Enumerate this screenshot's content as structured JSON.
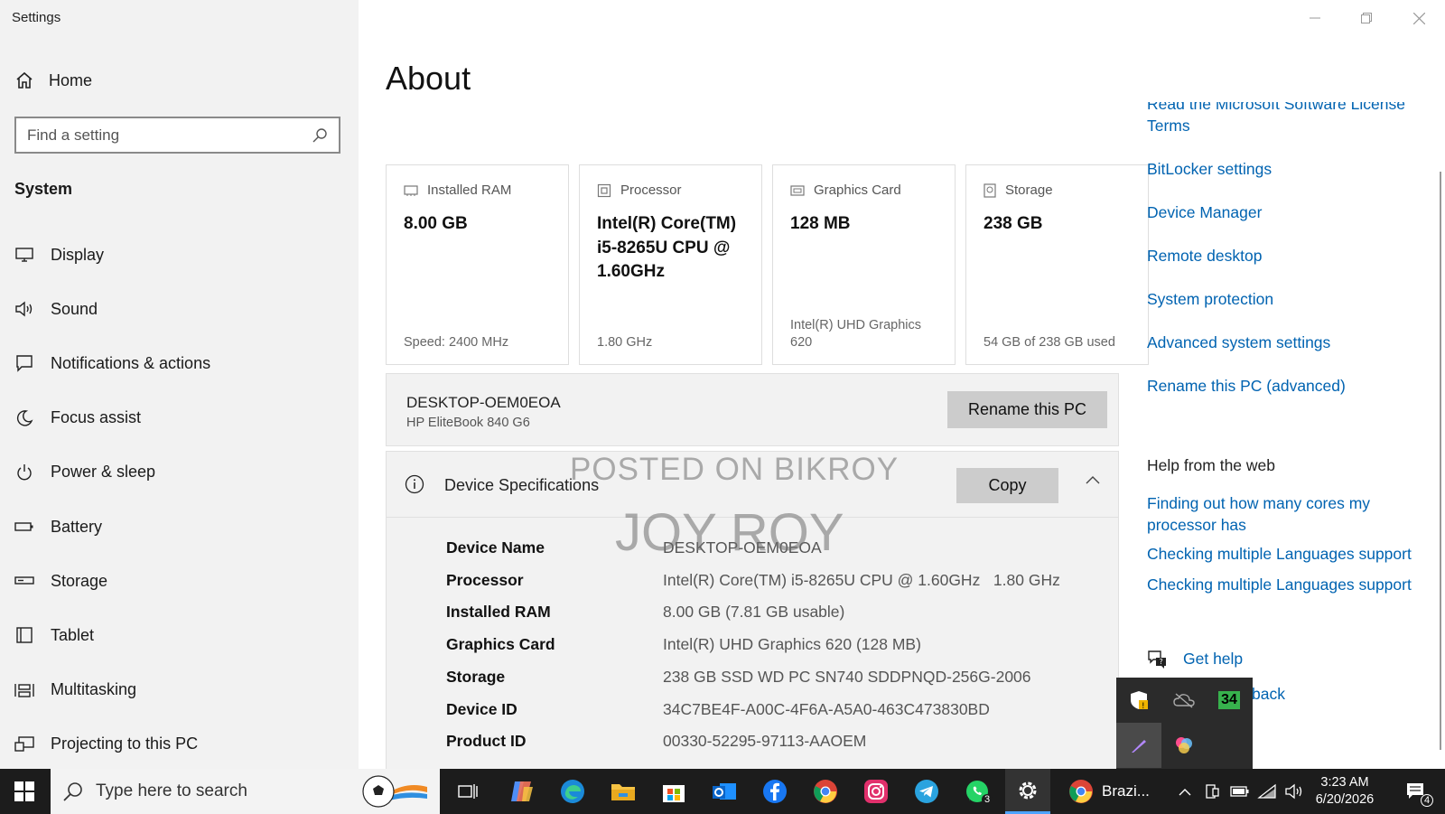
{
  "window": {
    "title": "Settings"
  },
  "sidebar": {
    "home_label": "Home",
    "search_placeholder": "Find a setting",
    "section_label": "System",
    "items": [
      {
        "label": "Display",
        "icon": "display-icon"
      },
      {
        "label": "Sound",
        "icon": "sound-icon"
      },
      {
        "label": "Notifications & actions",
        "icon": "notifications-icon"
      },
      {
        "label": "Focus assist",
        "icon": "focus-assist-icon"
      },
      {
        "label": "Power & sleep",
        "icon": "power-icon"
      },
      {
        "label": "Battery",
        "icon": "battery-icon"
      },
      {
        "label": "Storage",
        "icon": "storage-icon"
      },
      {
        "label": "Tablet",
        "icon": "tablet-icon"
      },
      {
        "label": "Multitasking",
        "icon": "multitasking-icon"
      },
      {
        "label": "Projecting to this PC",
        "icon": "projecting-icon"
      }
    ]
  },
  "main": {
    "title": "About",
    "cards": [
      {
        "head": "Installed RAM",
        "value": "8.00 GB",
        "sub": "Speed: 2400 MHz",
        "icon": "ram-icon"
      },
      {
        "head": "Processor",
        "value": "Intel(R) Core(TM) i5-8265U CPU @ 1.60GHz",
        "sub": "1.80 GHz",
        "icon": "processor-icon"
      },
      {
        "head": "Graphics Card",
        "value": "128 MB",
        "sub": "Intel(R) UHD Graphics 620",
        "icon": "graphics-card-icon"
      },
      {
        "head": "Storage",
        "value": "238 GB",
        "sub": "54 GB of 238 GB used",
        "icon": "storage-drive-icon"
      }
    ],
    "pc": {
      "name": "DESKTOP-OEM0EOA",
      "model": "HP EliteBook 840 G6",
      "rename_label": "Rename this PC"
    },
    "specs": {
      "title": "Device Specifications",
      "copy_label": "Copy",
      "rows": [
        {
          "key": "Device Name",
          "value": "DESKTOP-OEM0EOA"
        },
        {
          "key": "Processor",
          "value": "Intel(R) Core(TM) i5-8265U CPU @ 1.60GHz   1.80 GHz"
        },
        {
          "key": "Installed RAM",
          "value": "8.00 GB (7.81 GB usable)"
        },
        {
          "key": "Graphics Card",
          "value": "Intel(R) UHD Graphics 620 (128 MB)"
        },
        {
          "key": "Storage",
          "value": "238 GB SSD WD PC SN740 SDDPNQD-256G-2006"
        },
        {
          "key": "Device ID",
          "value": "34C7BE4F-A00C-4F6A-A5A0-463C473830BD"
        },
        {
          "key": "Product ID",
          "value": "00330-52295-97113-AAOEM"
        }
      ]
    },
    "watermark": {
      "line1": "POSTED ON BIKROY",
      "line2": "JOY ROY"
    }
  },
  "related": {
    "partial_link": "Read the Microsoft Software License",
    "partial_link_2": "Terms",
    "links": [
      "BitLocker settings",
      "Device Manager",
      "Remote desktop",
      "System protection",
      "Advanced system settings",
      "Rename this PC (advanced)"
    ],
    "help_title": "Help from the web",
    "help_links": [
      "Finding out how many cores my processor has",
      "Checking multiple Languages support",
      "Checking multiple Languages support"
    ],
    "get_help": "Get help",
    "feedback_partial": "back"
  },
  "tray_popup": {
    "badge_value": "34"
  },
  "taskbar": {
    "search_placeholder": "Type here to search",
    "chrome_label": "Brazi...",
    "whatsapp_badge": "3",
    "time": "3:23 AM",
    "date": "6/20/2026",
    "notification_count": "4"
  }
}
